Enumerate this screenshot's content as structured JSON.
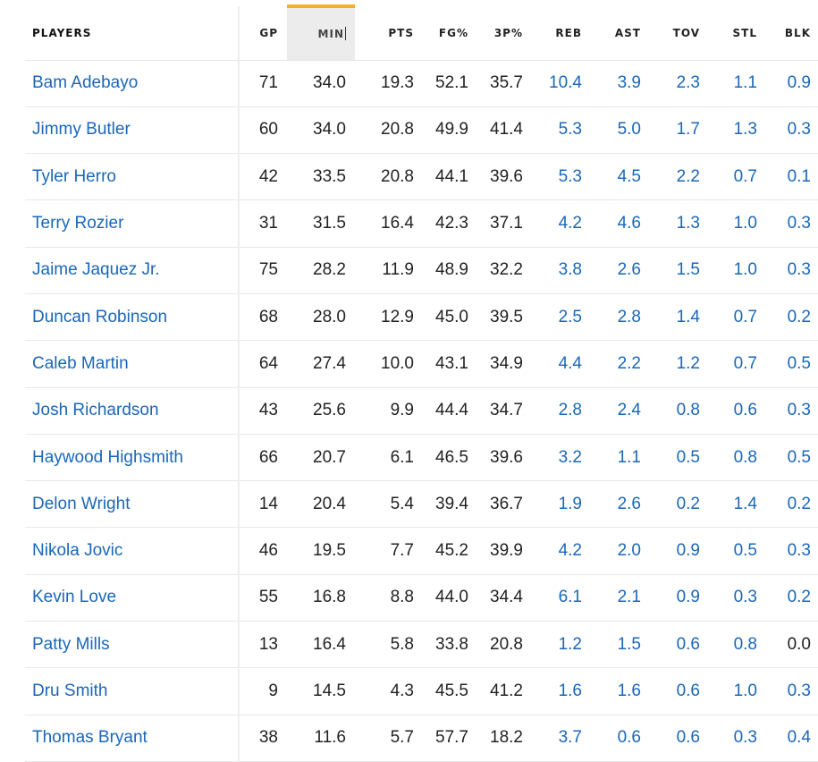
{
  "table": {
    "columns": [
      {
        "key": "player",
        "label": "PLAYERS"
      },
      {
        "key": "gp",
        "label": "GP"
      },
      {
        "key": "min",
        "label": "MIN",
        "sorted": true
      },
      {
        "key": "pts",
        "label": "PTS"
      },
      {
        "key": "fg",
        "label": "FG%"
      },
      {
        "key": "tp",
        "label": "3P%"
      },
      {
        "key": "reb",
        "label": "REB"
      },
      {
        "key": "ast",
        "label": "AST"
      },
      {
        "key": "tov",
        "label": "TOV"
      },
      {
        "key": "stl",
        "label": "STL"
      },
      {
        "key": "blk",
        "label": "BLK"
      }
    ],
    "rows": [
      {
        "player": "Bam Adebayo",
        "gp": "71",
        "min": "34.0",
        "pts": "19.3",
        "fg": "52.1",
        "tp": "35.7",
        "reb": "10.4",
        "ast": "3.9",
        "tov": "2.3",
        "stl": "1.1",
        "blk": "0.9"
      },
      {
        "player": "Jimmy Butler",
        "gp": "60",
        "min": "34.0",
        "pts": "20.8",
        "fg": "49.9",
        "tp": "41.4",
        "reb": "5.3",
        "ast": "5.0",
        "tov": "1.7",
        "stl": "1.3",
        "blk": "0.3"
      },
      {
        "player": "Tyler Herro",
        "gp": "42",
        "min": "33.5",
        "pts": "20.8",
        "fg": "44.1",
        "tp": "39.6",
        "reb": "5.3",
        "ast": "4.5",
        "tov": "2.2",
        "stl": "0.7",
        "blk": "0.1"
      },
      {
        "player": "Terry Rozier",
        "gp": "31",
        "min": "31.5",
        "pts": "16.4",
        "fg": "42.3",
        "tp": "37.1",
        "reb": "4.2",
        "ast": "4.6",
        "tov": "1.3",
        "stl": "1.0",
        "blk": "0.3"
      },
      {
        "player": "Jaime Jaquez Jr.",
        "gp": "75",
        "min": "28.2",
        "pts": "11.9",
        "fg": "48.9",
        "tp": "32.2",
        "reb": "3.8",
        "ast": "2.6",
        "tov": "1.5",
        "stl": "1.0",
        "blk": "0.3"
      },
      {
        "player": "Duncan Robinson",
        "gp": "68",
        "min": "28.0",
        "pts": "12.9",
        "fg": "45.0",
        "tp": "39.5",
        "reb": "2.5",
        "ast": "2.8",
        "tov": "1.4",
        "stl": "0.7",
        "blk": "0.2"
      },
      {
        "player": "Caleb Martin",
        "gp": "64",
        "min": "27.4",
        "pts": "10.0",
        "fg": "43.1",
        "tp": "34.9",
        "reb": "4.4",
        "ast": "2.2",
        "tov": "1.2",
        "stl": "0.7",
        "blk": "0.5"
      },
      {
        "player": "Josh Richardson",
        "gp": "43",
        "min": "25.6",
        "pts": "9.9",
        "fg": "44.4",
        "tp": "34.7",
        "reb": "2.8",
        "ast": "2.4",
        "tov": "0.8",
        "stl": "0.6",
        "blk": "0.3"
      },
      {
        "player": "Haywood Highsmith",
        "gp": "66",
        "min": "20.7",
        "pts": "6.1",
        "fg": "46.5",
        "tp": "39.6",
        "reb": "3.2",
        "ast": "1.1",
        "tov": "0.5",
        "stl": "0.8",
        "blk": "0.5"
      },
      {
        "player": "Delon Wright",
        "gp": "14",
        "min": "20.4",
        "pts": "5.4",
        "fg": "39.4",
        "tp": "36.7",
        "reb": "1.9",
        "ast": "2.6",
        "tov": "0.2",
        "stl": "1.4",
        "blk": "0.2"
      },
      {
        "player": "Nikola Jovic",
        "gp": "46",
        "min": "19.5",
        "pts": "7.7",
        "fg": "45.2",
        "tp": "39.9",
        "reb": "4.2",
        "ast": "2.0",
        "tov": "0.9",
        "stl": "0.5",
        "blk": "0.3"
      },
      {
        "player": "Kevin Love",
        "gp": "55",
        "min": "16.8",
        "pts": "8.8",
        "fg": "44.0",
        "tp": "34.4",
        "reb": "6.1",
        "ast": "2.1",
        "tov": "0.9",
        "stl": "0.3",
        "blk": "0.2"
      },
      {
        "player": "Patty Mills",
        "gp": "13",
        "min": "16.4",
        "pts": "5.8",
        "fg": "33.8",
        "tp": "20.8",
        "reb": "1.2",
        "ast": "1.5",
        "tov": "0.6",
        "stl": "0.8",
        "blk": "0.0"
      },
      {
        "player": "Dru Smith",
        "gp": "9",
        "min": "14.5",
        "pts": "4.3",
        "fg": "45.5",
        "tp": "41.2",
        "reb": "1.6",
        "ast": "1.6",
        "tov": "0.6",
        "stl": "1.0",
        "blk": "0.3"
      },
      {
        "player": "Thomas Bryant",
        "gp": "38",
        "min": "11.6",
        "pts": "5.7",
        "fg": "57.7",
        "tp": "18.2",
        "reb": "3.7",
        "ast": "0.6",
        "tov": "0.6",
        "stl": "0.3",
        "blk": "0.4"
      }
    ]
  },
  "colors": {
    "link": "#1a67b8",
    "sort_accent": "#f0b323",
    "sorted_header_bg": "#ececec",
    "text": "#222222",
    "row_border": "#e8e8e8"
  }
}
